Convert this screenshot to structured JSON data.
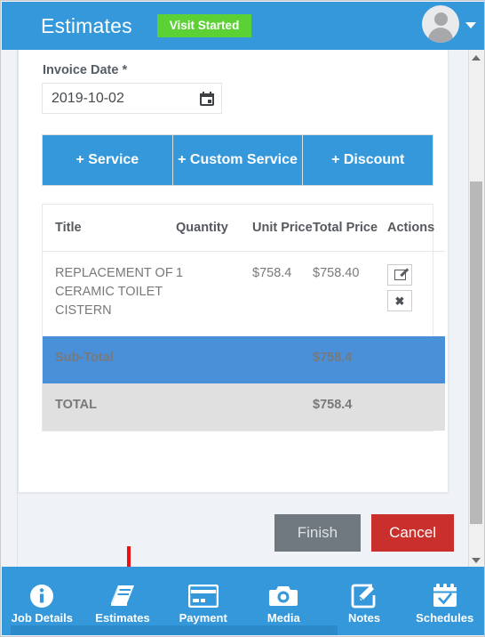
{
  "header": {
    "title": "Estimates",
    "status_badge": "Visit Started",
    "avatar_icon": "user-avatar-icon",
    "caret_icon": "chevron-down-icon"
  },
  "form": {
    "invoice_date_label": "Invoice Date *",
    "invoice_date_value": "2019-10-02",
    "calendar_icon": "calendar-icon"
  },
  "add_buttons": [
    {
      "label": "+ Service"
    },
    {
      "label": "+ Custom Service"
    },
    {
      "label": "+ Discount"
    }
  ],
  "items_table": {
    "columns": [
      "Title",
      "Quantity",
      "Unit Price",
      "Total Price",
      "Actions"
    ],
    "rows": [
      {
        "title": "REPLACEMENT OF CERAMIC TOILET CISTERN",
        "quantity": "1",
        "unit_price": "$758.4",
        "total_price": "$758.40",
        "edit_icon": "edit-icon",
        "delete_icon": "close-icon"
      }
    ],
    "subtotal_label": "Sub-Total",
    "subtotal_value": "$758.4",
    "total_label": "TOTAL",
    "total_value": "$758.4"
  },
  "footer": {
    "finish_label": "Finish",
    "cancel_label": "Cancel"
  },
  "bottom_nav": [
    {
      "label": "Job Details",
      "icon": "info-circle-icon"
    },
    {
      "label": "Estimates",
      "icon": "book-icon"
    },
    {
      "label": "Payment",
      "icon": "credit-card-icon"
    },
    {
      "label": "Media",
      "icon": "camera-icon"
    },
    {
      "label": "Notes",
      "icon": "edit-square-icon"
    },
    {
      "label": "Schedules",
      "icon": "calendar-check-icon"
    }
  ],
  "annotation": {
    "arrow_color": "#ee1111",
    "arrow_target": "Estimates"
  },
  "colors": {
    "brand_blue": "#3498db",
    "status_green": "#5cd135",
    "subtotal_blue": "#4a90d9",
    "total_gray": "#e0e0e0",
    "cancel_red": "#c9302c",
    "finish_gray": "#70797f",
    "page_background": "#eff2f7"
  }
}
